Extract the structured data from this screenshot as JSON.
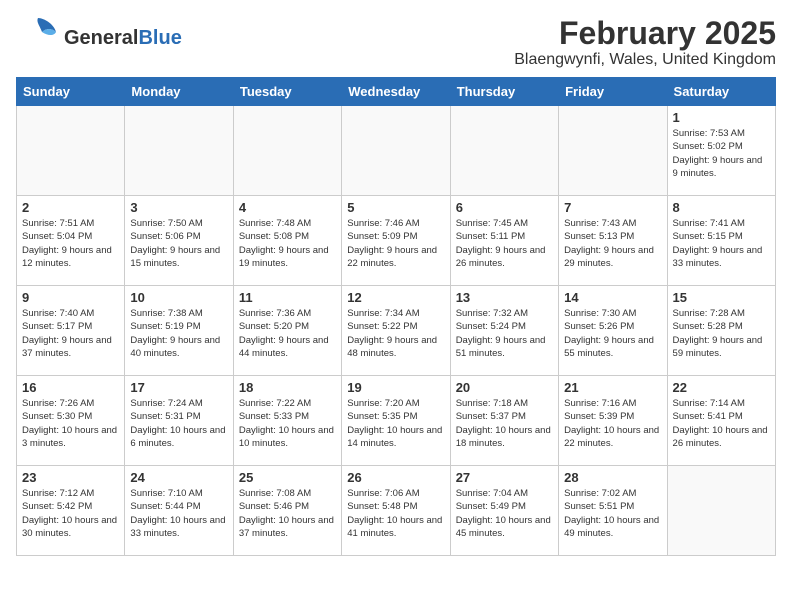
{
  "header": {
    "logo_general": "General",
    "logo_blue": "Blue",
    "title": "February 2025",
    "subtitle": "Blaengwynfi, Wales, United Kingdom"
  },
  "weekdays": [
    "Sunday",
    "Monday",
    "Tuesday",
    "Wednesday",
    "Thursday",
    "Friday",
    "Saturday"
  ],
  "weeks": [
    [
      {
        "day": "",
        "info": ""
      },
      {
        "day": "",
        "info": ""
      },
      {
        "day": "",
        "info": ""
      },
      {
        "day": "",
        "info": ""
      },
      {
        "day": "",
        "info": ""
      },
      {
        "day": "",
        "info": ""
      },
      {
        "day": "1",
        "info": "Sunrise: 7:53 AM\nSunset: 5:02 PM\nDaylight: 9 hours and 9 minutes."
      }
    ],
    [
      {
        "day": "2",
        "info": "Sunrise: 7:51 AM\nSunset: 5:04 PM\nDaylight: 9 hours and 12 minutes."
      },
      {
        "day": "3",
        "info": "Sunrise: 7:50 AM\nSunset: 5:06 PM\nDaylight: 9 hours and 15 minutes."
      },
      {
        "day": "4",
        "info": "Sunrise: 7:48 AM\nSunset: 5:08 PM\nDaylight: 9 hours and 19 minutes."
      },
      {
        "day": "5",
        "info": "Sunrise: 7:46 AM\nSunset: 5:09 PM\nDaylight: 9 hours and 22 minutes."
      },
      {
        "day": "6",
        "info": "Sunrise: 7:45 AM\nSunset: 5:11 PM\nDaylight: 9 hours and 26 minutes."
      },
      {
        "day": "7",
        "info": "Sunrise: 7:43 AM\nSunset: 5:13 PM\nDaylight: 9 hours and 29 minutes."
      },
      {
        "day": "8",
        "info": "Sunrise: 7:41 AM\nSunset: 5:15 PM\nDaylight: 9 hours and 33 minutes."
      }
    ],
    [
      {
        "day": "9",
        "info": "Sunrise: 7:40 AM\nSunset: 5:17 PM\nDaylight: 9 hours and 37 minutes."
      },
      {
        "day": "10",
        "info": "Sunrise: 7:38 AM\nSunset: 5:19 PM\nDaylight: 9 hours and 40 minutes."
      },
      {
        "day": "11",
        "info": "Sunrise: 7:36 AM\nSunset: 5:20 PM\nDaylight: 9 hours and 44 minutes."
      },
      {
        "day": "12",
        "info": "Sunrise: 7:34 AM\nSunset: 5:22 PM\nDaylight: 9 hours and 48 minutes."
      },
      {
        "day": "13",
        "info": "Sunrise: 7:32 AM\nSunset: 5:24 PM\nDaylight: 9 hours and 51 minutes."
      },
      {
        "day": "14",
        "info": "Sunrise: 7:30 AM\nSunset: 5:26 PM\nDaylight: 9 hours and 55 minutes."
      },
      {
        "day": "15",
        "info": "Sunrise: 7:28 AM\nSunset: 5:28 PM\nDaylight: 9 hours and 59 minutes."
      }
    ],
    [
      {
        "day": "16",
        "info": "Sunrise: 7:26 AM\nSunset: 5:30 PM\nDaylight: 10 hours and 3 minutes."
      },
      {
        "day": "17",
        "info": "Sunrise: 7:24 AM\nSunset: 5:31 PM\nDaylight: 10 hours and 6 minutes."
      },
      {
        "day": "18",
        "info": "Sunrise: 7:22 AM\nSunset: 5:33 PM\nDaylight: 10 hours and 10 minutes."
      },
      {
        "day": "19",
        "info": "Sunrise: 7:20 AM\nSunset: 5:35 PM\nDaylight: 10 hours and 14 minutes."
      },
      {
        "day": "20",
        "info": "Sunrise: 7:18 AM\nSunset: 5:37 PM\nDaylight: 10 hours and 18 minutes."
      },
      {
        "day": "21",
        "info": "Sunrise: 7:16 AM\nSunset: 5:39 PM\nDaylight: 10 hours and 22 minutes."
      },
      {
        "day": "22",
        "info": "Sunrise: 7:14 AM\nSunset: 5:41 PM\nDaylight: 10 hours and 26 minutes."
      }
    ],
    [
      {
        "day": "23",
        "info": "Sunrise: 7:12 AM\nSunset: 5:42 PM\nDaylight: 10 hours and 30 minutes."
      },
      {
        "day": "24",
        "info": "Sunrise: 7:10 AM\nSunset: 5:44 PM\nDaylight: 10 hours and 33 minutes."
      },
      {
        "day": "25",
        "info": "Sunrise: 7:08 AM\nSunset: 5:46 PM\nDaylight: 10 hours and 37 minutes."
      },
      {
        "day": "26",
        "info": "Sunrise: 7:06 AM\nSunset: 5:48 PM\nDaylight: 10 hours and 41 minutes."
      },
      {
        "day": "27",
        "info": "Sunrise: 7:04 AM\nSunset: 5:49 PM\nDaylight: 10 hours and 45 minutes."
      },
      {
        "day": "28",
        "info": "Sunrise: 7:02 AM\nSunset: 5:51 PM\nDaylight: 10 hours and 49 minutes."
      },
      {
        "day": "",
        "info": ""
      }
    ]
  ]
}
